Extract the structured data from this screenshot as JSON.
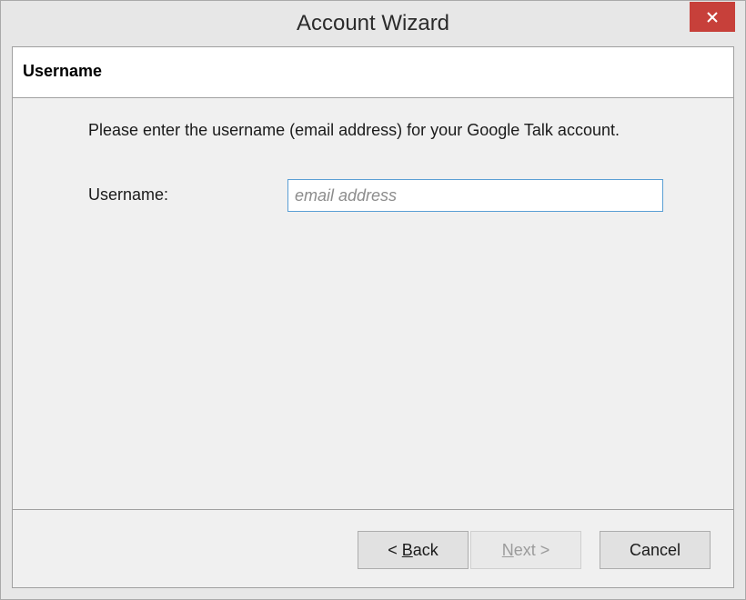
{
  "window": {
    "title": "Account Wizard",
    "close_icon": "close-icon"
  },
  "header": {
    "title": "Username"
  },
  "main": {
    "instruction": "Please enter the username (email address) for your Google Talk account.",
    "username_label": "Username:",
    "username_value": "",
    "username_placeholder": "email address"
  },
  "footer": {
    "back_mnemonic": "B",
    "back_rest": "ack",
    "back_prefix": "< ",
    "next_mnemonic": "N",
    "next_rest": "ext >",
    "next_enabled": false,
    "cancel_label": "Cancel"
  },
  "colors": {
    "close_button": "#c7403a",
    "input_focus_border": "#5a9fd4",
    "window_background": "#e7e7e7",
    "panel_background": "#f0f0f0",
    "header_background": "#ffffff"
  }
}
